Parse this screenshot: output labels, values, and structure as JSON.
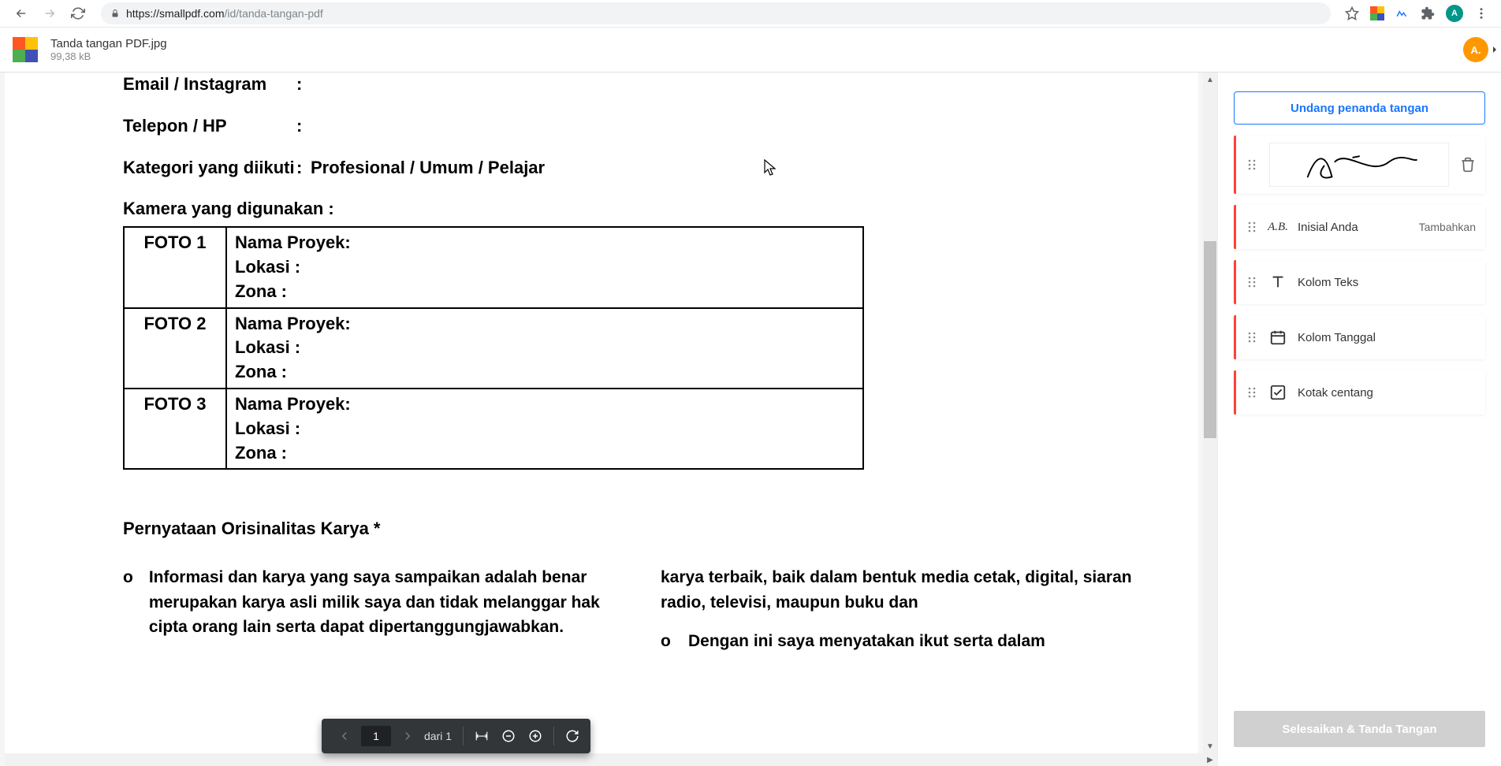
{
  "browser": {
    "url_host": "https://smallpdf.com",
    "url_path": "/id/tanda-tangan-pdf",
    "avatar_initial": "A"
  },
  "header": {
    "file_name": "Tanda tangan PDF.jpg",
    "file_size": "99,38 kB",
    "user_initial": "A."
  },
  "document": {
    "rows": [
      {
        "label": "Email / Instagram",
        "value": ""
      },
      {
        "label": "Telepon / HP",
        "value": ""
      },
      {
        "label": "Kategori yang diikuti",
        "value": "Profesional / Umum / Pelajar"
      }
    ],
    "camera_label": "Kamera yang digunakan :",
    "table": [
      {
        "foto": "FOTO 1",
        "l1": "Nama Proyek:",
        "l2": "Lokasi :",
        "l3": "Zona :"
      },
      {
        "foto": "FOTO 2",
        "l1": "Nama Proyek:",
        "l2": "Lokasi :",
        "l3": "Zona :"
      },
      {
        "foto": "FOTO 3",
        "l1": "Nama Proyek:",
        "l2": "Lokasi :",
        "l3": "Zona :"
      }
    ],
    "statement_title": "Pernyataan Orisinalitas Karya *",
    "stmt_left": "Informasi dan karya yang saya sampaikan adalah benar merupakan karya asli milik saya dan tidak melanggar hak cipta orang lain serta dapat dipertanggungjawabkan.",
    "stmt_right_top": "karya terbaik, baik dalam bentuk media cetak, digital, siaran radio, televisi, maupun buku dan",
    "stmt_right_bullet": "Dengan ini saya menyatakan ikut serta dalam"
  },
  "pdfbar": {
    "page_current": "1",
    "page_total": "dari 1"
  },
  "side": {
    "invite": "Undang penanda tangan",
    "initials_label": "Inisial Anda",
    "initials_action": "Tambahkan",
    "text_label": "Kolom Teks",
    "date_label": "Kolom Tanggal",
    "check_label": "Kotak centang",
    "finish": "Selesaikan & Tanda Tangan",
    "ab_text": "A.B."
  }
}
